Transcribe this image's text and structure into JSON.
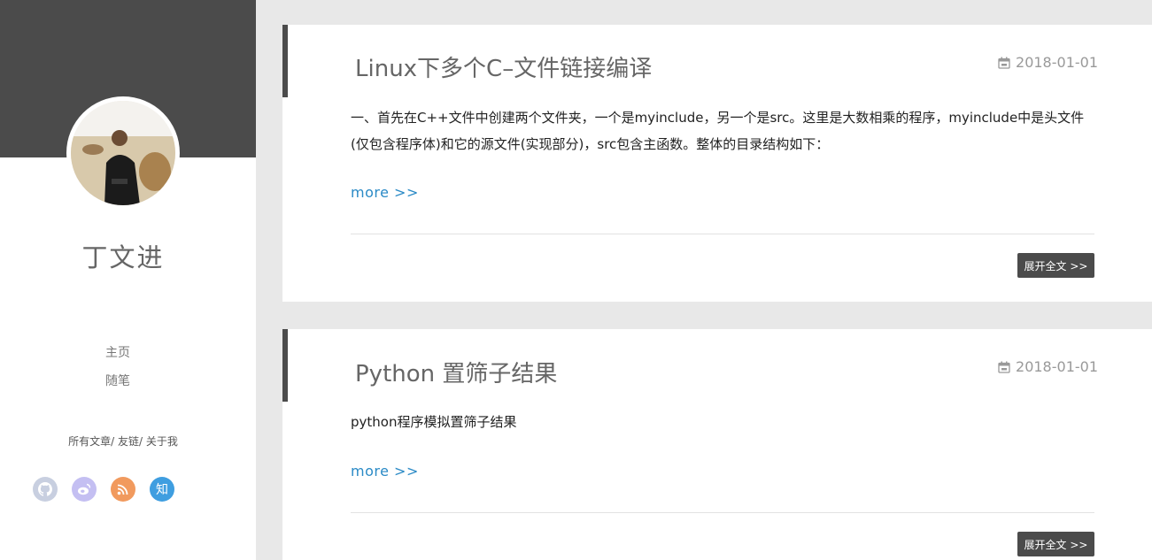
{
  "sidebar": {
    "author_name": "丁文进",
    "nav": [
      {
        "label": "主页"
      },
      {
        "label": "随笔"
      }
    ],
    "links": [
      {
        "label": "所有文章"
      },
      {
        "label": "友链"
      },
      {
        "label": "关于我"
      }
    ],
    "link_separator": "/",
    "social": [
      {
        "icon": "github-icon",
        "color": "#c8cfe0"
      },
      {
        "icon": "weibo-icon",
        "color": "#c4bff2"
      },
      {
        "icon": "rss-icon",
        "color": "#f19a5e"
      },
      {
        "icon": "zhihu-icon",
        "label": "知",
        "color": "#3f9ee0"
      }
    ]
  },
  "posts": [
    {
      "title": "Linux下多个C–文件链接编译",
      "date": "2018-01-01",
      "excerpt": "一、首先在C++文件中创建两个文件夹，一个是myinclude，另一个是src。这里是大数相乘的程序，myinclude中是头文件(仅包含程序体)和它的源文件(实现部分)，src包含主函数。整体的目录结构如下：",
      "more": "more >>",
      "read_full": "展开全文 >>"
    },
    {
      "title": "Python 置筛子结果",
      "date": "2018-01-01",
      "excerpt": "python程序模拟置筛子结果",
      "more": "more >>",
      "read_full": "展开全文 >>"
    }
  ]
}
